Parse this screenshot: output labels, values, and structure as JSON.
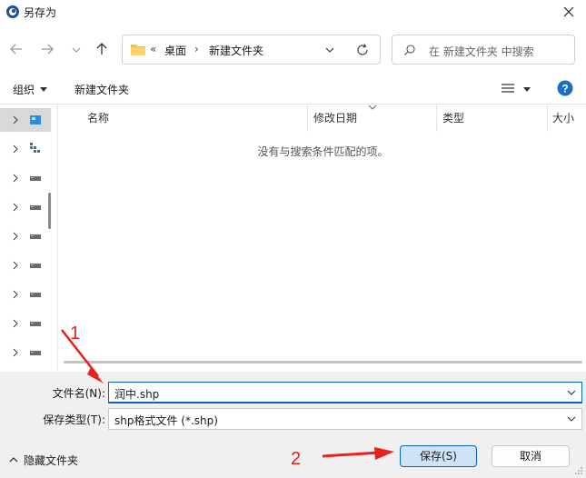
{
  "window": {
    "title": "另存为"
  },
  "address": {
    "prefix": "«",
    "crumbs": [
      "桌面",
      "新建文件夹"
    ],
    "sep": "›"
  },
  "search": {
    "placeholder": "在 新建文件夹 中搜索"
  },
  "toolbar": {
    "organize": "组织",
    "new_folder": "新建文件夹"
  },
  "sidebar": {
    "items": [
      "drive-icon",
      "network-icon",
      "drive-icon",
      "drive-icon",
      "drive-icon",
      "drive-icon",
      "drive-icon",
      "drive-icon",
      "drive-icon",
      "drive-icon"
    ]
  },
  "filelist": {
    "columns": [
      "名称",
      "修改日期",
      "类型",
      "大小"
    ],
    "empty_message": "没有与搜索条件匹配的项。"
  },
  "form": {
    "filename_label": "文件名(N):",
    "filename_value": "润中.shp",
    "filetype_label": "保存类型(T):",
    "filetype_value": "shp格式文件 (*.shp)"
  },
  "footer": {
    "hide_folders": "隐藏文件夹",
    "save": "保存(S)",
    "cancel": "取消"
  },
  "annotations": {
    "one": "1",
    "two": "2",
    "color": "#e8211c"
  },
  "colors": {
    "accent": "#0a64c8",
    "folder": "#f5c242"
  }
}
